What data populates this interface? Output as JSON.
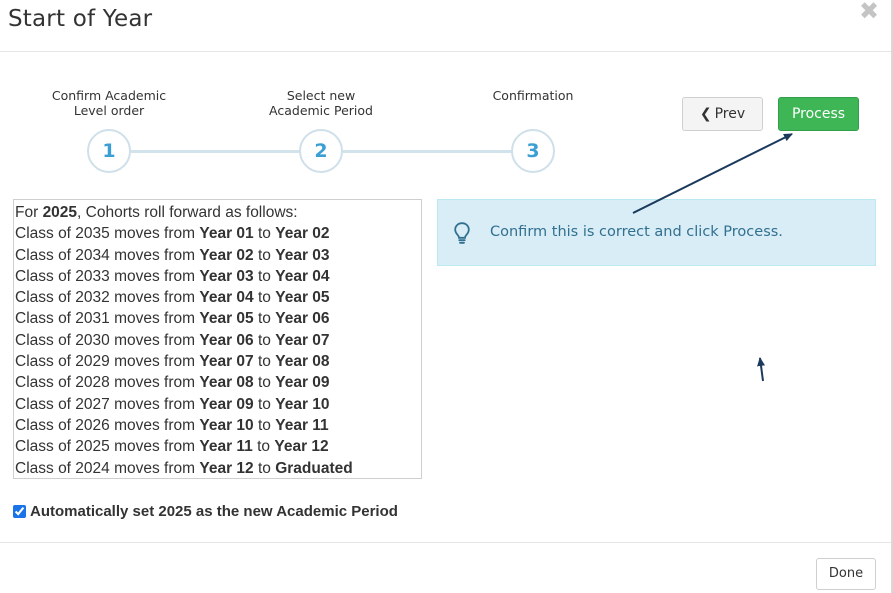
{
  "modal": {
    "title": "Start of Year",
    "close_glyph": "✖"
  },
  "wizard": {
    "steps": [
      {
        "number": "1",
        "label_line1": "Confirm Academic",
        "label_line2": "Level order"
      },
      {
        "number": "2",
        "label_line1": "Select new",
        "label_line2": "Academic Period"
      },
      {
        "number": "3",
        "label_line1": "Confirmation",
        "label_line2": ""
      }
    ]
  },
  "buttons": {
    "prev_label": "Prev",
    "process_label": "Process",
    "done_label": "Done"
  },
  "rollover": {
    "header": {
      "prefix": "For ",
      "year": "2025",
      "suffix": ", Cohorts roll forward as follows:"
    },
    "connector_from": " moves from ",
    "connector_to": " to ",
    "rows": [
      {
        "class": "Class of 2035",
        "from": "Year 01",
        "to": "Year 02"
      },
      {
        "class": "Class of 2034",
        "from": "Year 02",
        "to": "Year 03"
      },
      {
        "class": "Class of 2033",
        "from": "Year 03",
        "to": "Year 04"
      },
      {
        "class": "Class of 2032",
        "from": "Year 04",
        "to": "Year 05"
      },
      {
        "class": "Class of 2031",
        "from": "Year 05",
        "to": "Year 06"
      },
      {
        "class": "Class of 2030",
        "from": "Year 06",
        "to": "Year 07"
      },
      {
        "class": "Class of 2029",
        "from": "Year 07",
        "to": "Year 08"
      },
      {
        "class": "Class of 2028",
        "from": "Year 08",
        "to": "Year 09"
      },
      {
        "class": "Class of 2027",
        "from": "Year 09",
        "to": "Year 10"
      },
      {
        "class": "Class of 2026",
        "from": "Year 10",
        "to": "Year 11"
      },
      {
        "class": "Class of 2025",
        "from": "Year 11",
        "to": "Year 12"
      },
      {
        "class": "Class of 2024",
        "from": "Year 12",
        "to": "Graduated"
      }
    ]
  },
  "info": {
    "icon": "lightbulb-icon",
    "text": "Confirm this is correct and click Process."
  },
  "auto_set": {
    "checked": true,
    "label": "Automatically set 2025 as the new Academic Period"
  },
  "colors": {
    "process_green": "#3fb656",
    "step_blue": "#3b9fd4",
    "info_bg": "#d9edf7",
    "info_text": "#31708f",
    "annotation_arrow": "#1b3a5c"
  }
}
